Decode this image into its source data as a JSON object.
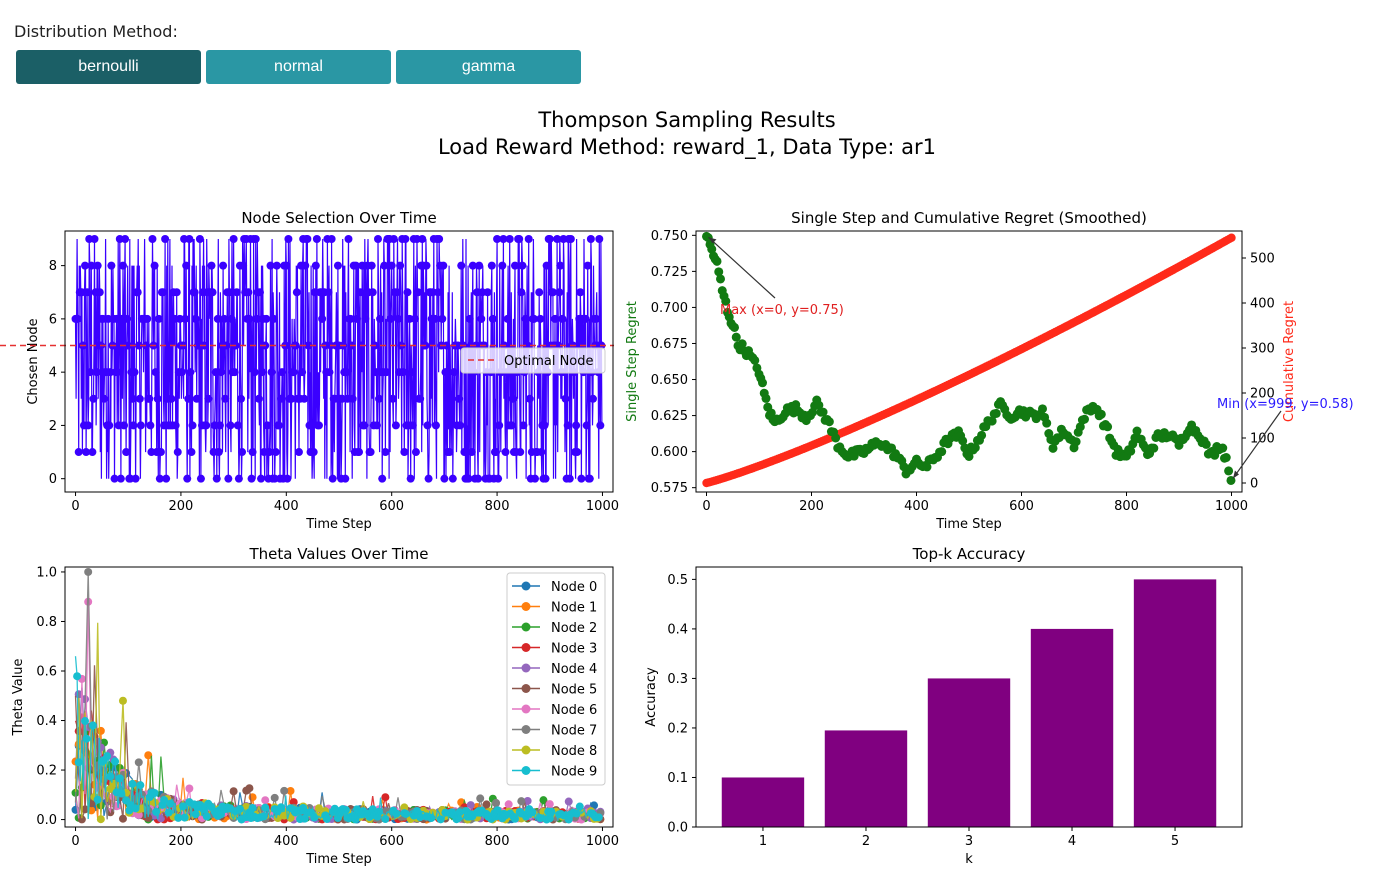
{
  "controls": {
    "label": "Distribution Method:",
    "buttons": [
      {
        "label": "bernoulli",
        "active": true
      },
      {
        "label": "normal",
        "active": false
      },
      {
        "label": "gamma",
        "active": false
      }
    ]
  },
  "figure": {
    "title_line1": "Thompson Sampling Results",
    "title_line2": "Load Reward Method: reward_1, Data Type: ar1"
  },
  "colors": {
    "selection": "#3a00ff",
    "optimal": "#e53030",
    "single_regret": "#127a12",
    "cumulative_regret": "#ff2a1a",
    "bars": "#800080",
    "active_button": "#1b5f66",
    "button": "#2a97a4"
  },
  "chart_data": [
    {
      "type": "line",
      "title": "Node Selection Over Time",
      "xlabel": "Time Step",
      "ylabel": "Chosen Node",
      "xlim": [
        -20,
        1020
      ],
      "ylim": [
        -0.5,
        9.3
      ],
      "xticks": [
        0,
        200,
        400,
        600,
        800,
        1000
      ],
      "yticks": [
        0,
        2,
        4,
        6,
        8
      ],
      "optimal_node": 5,
      "legend": [
        "Optimal Node"
      ],
      "legend_position": "center-right",
      "series": [
        {
          "x_range": [
            0,
            999
          ],
          "values_range": [
            0,
            9
          ]
        }
      ]
    },
    {
      "type": "scatter",
      "title": "Single Step and Cumulative Regret (Smoothed)",
      "xlabel": "Time Step",
      "ylabel": "Single Step Regret",
      "ylabel_right": "Cumulative Regret",
      "xlim": [
        -20,
        1020
      ],
      "ylim": [
        0.572,
        0.753
      ],
      "ylim_right": [
        -20,
        560
      ],
      "xticks": [
        0,
        200,
        400,
        600,
        800,
        1000
      ],
      "yticks": [
        0.575,
        0.6,
        0.625,
        0.65,
        0.675,
        0.7,
        0.725,
        0.75
      ],
      "yticks_right": [
        0,
        100,
        200,
        300,
        400,
        500
      ],
      "single_step_points": [
        [
          0,
          0.75
        ],
        [
          10,
          0.74
        ],
        [
          20,
          0.73
        ],
        [
          30,
          0.712
        ],
        [
          40,
          0.698
        ],
        [
          50,
          0.688
        ],
        [
          60,
          0.675
        ],
        [
          80,
          0.668
        ],
        [
          100,
          0.656
        ],
        [
          110,
          0.64
        ],
        [
          120,
          0.627
        ],
        [
          130,
          0.62
        ],
        [
          150,
          0.628
        ],
        [
          170,
          0.63
        ],
        [
          190,
          0.624
        ],
        [
          210,
          0.633
        ],
        [
          230,
          0.622
        ],
        [
          250,
          0.605
        ],
        [
          270,
          0.597
        ],
        [
          300,
          0.6
        ],
        [
          330,
          0.607
        ],
        [
          360,
          0.598
        ],
        [
          380,
          0.587
        ],
        [
          400,
          0.592
        ],
        [
          420,
          0.59
        ],
        [
          440,
          0.598
        ],
        [
          460,
          0.608
        ],
        [
          480,
          0.612
        ],
        [
          500,
          0.598
        ],
        [
          520,
          0.61
        ],
        [
          540,
          0.622
        ],
        [
          560,
          0.632
        ],
        [
          580,
          0.625
        ],
        [
          600,
          0.628
        ],
        [
          620,
          0.625
        ],
        [
          640,
          0.627
        ],
        [
          660,
          0.605
        ],
        [
          680,
          0.615
        ],
        [
          700,
          0.605
        ],
        [
          720,
          0.625
        ],
        [
          740,
          0.632
        ],
        [
          760,
          0.618
        ],
        [
          780,
          0.6
        ],
        [
          800,
          0.595
        ],
        [
          820,
          0.613
        ],
        [
          840,
          0.598
        ],
        [
          860,
          0.61
        ],
        [
          880,
          0.612
        ],
        [
          900,
          0.605
        ],
        [
          920,
          0.618
        ],
        [
          940,
          0.612
        ],
        [
          960,
          0.597
        ],
        [
          980,
          0.605
        ],
        [
          990,
          0.595
        ],
        [
          999,
          0.58
        ]
      ],
      "cumulative_end": 545,
      "annotations": [
        {
          "text": "Max (x=0, y=0.75)"
        },
        {
          "text": "Min (x=999, y=0.58)"
        }
      ]
    },
    {
      "type": "scatter",
      "title": "Theta Values Over Time",
      "xlabel": "Time Step",
      "ylabel": "Theta Value",
      "xlim": [
        -20,
        1020
      ],
      "ylim": [
        -0.03,
        1.02
      ],
      "xticks": [
        0,
        200,
        400,
        600,
        800,
        1000
      ],
      "yticks": [
        0.0,
        0.2,
        0.4,
        0.6,
        0.8,
        1.0
      ],
      "legend_position": "top-right",
      "series": [
        {
          "name": "Node 0",
          "color": "#1f77b4"
        },
        {
          "name": "Node 1",
          "color": "#ff7f0e"
        },
        {
          "name": "Node 2",
          "color": "#2ca02c"
        },
        {
          "name": "Node 3",
          "color": "#d62728"
        },
        {
          "name": "Node 4",
          "color": "#9467bd"
        },
        {
          "name": "Node 5",
          "color": "#8c564b"
        },
        {
          "name": "Node 6",
          "color": "#e377c2"
        },
        {
          "name": "Node 7",
          "color": "#7f7f7f"
        },
        {
          "name": "Node 8",
          "color": "#bcbd22"
        },
        {
          "name": "Node 9",
          "color": "#17becf"
        }
      ]
    },
    {
      "type": "bar",
      "title": "Top-k Accuracy",
      "xlabel": "k",
      "ylabel": "Accuracy",
      "categories": [
        "1",
        "2",
        "3",
        "4",
        "5"
      ],
      "values": [
        0.1,
        0.195,
        0.3,
        0.4,
        0.5
      ],
      "ylim": [
        0,
        0.525
      ],
      "yticks": [
        0.0,
        0.1,
        0.2,
        0.3,
        0.4,
        0.5
      ]
    }
  ]
}
